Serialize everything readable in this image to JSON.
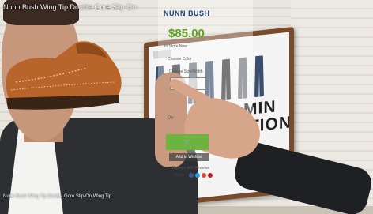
{
  "overlay": {
    "product_name": "Nunn Bush Wing Tip Double Gore Slip-On",
    "brand": "NUNN BUSH",
    "price": "$85.00",
    "in_store_label": "In Store Now",
    "color_label": "Choose Color",
    "size_label": "Choose Size/Width",
    "qty_label": "Qty",
    "add_to_wishlist": "Add to Wishlist",
    "reviews_label": "Ratings and Reviews",
    "share_label": "Share:",
    "caption": "Nunn Bush Wing Tip Double Gore Slip-On Wing Tip"
  },
  "kiosk": {
    "banner_text_line1": "MIN",
    "banner_text_line2": "ITION"
  },
  "colors": {
    "price_green": "#5ea31d",
    "brand_blue": "#1e3c72",
    "cart_button": "#6db33f",
    "kiosk_frame": "#7a4a2c",
    "share_icons": [
      "#3b5998",
      "#1da1f2",
      "#dd4b39",
      "#cb2027"
    ]
  },
  "icons": [
    "facebook-icon",
    "twitter-icon",
    "google-plus-icon",
    "pinterest-icon"
  ]
}
